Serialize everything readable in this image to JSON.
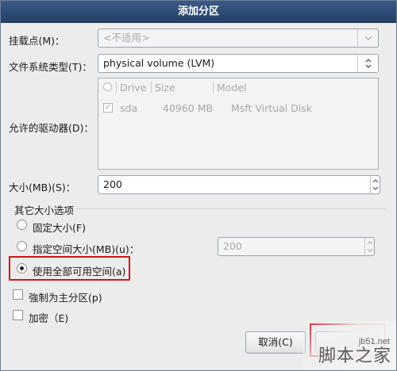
{
  "dialog": {
    "title": "添加分区"
  },
  "mount_point": {
    "label": "挂载点(M)：",
    "value": "<不适用>",
    "button_icon": "chevron-down-icon"
  },
  "fs_type": {
    "label": "文件系统类型(T)：",
    "value": "physical volume (LVM)",
    "button_icon": "updown-icon"
  },
  "drives": {
    "label": "允许的驱动器(D)：",
    "columns": [
      "Drive",
      "Size",
      "Model"
    ],
    "rows": [
      {
        "drive": "sda",
        "size": "40960 MB",
        "model": "Msft Virtual Disk",
        "checked": true
      }
    ]
  },
  "size": {
    "label": "大小(MB)(S)：",
    "value": "200"
  },
  "size_options": {
    "group_label": "其它大小选项",
    "fixed_label": "固定大小(F)",
    "upto_label": "指定空间大小(MB)(u)：",
    "upto_value": "200",
    "fill_label": "使用全部可用空间(a)",
    "selected": "fill"
  },
  "primary": {
    "label": "強制为主分区(p)"
  },
  "encrypt": {
    "label": "加密（E)"
  },
  "buttons": {
    "cancel_label": "取消(C)"
  },
  "watermark": {
    "site": "jb51.net",
    "name": "脚本之家"
  },
  "colors": {
    "title_bar": "#2f4c77",
    "highlight": "#d0151b"
  }
}
